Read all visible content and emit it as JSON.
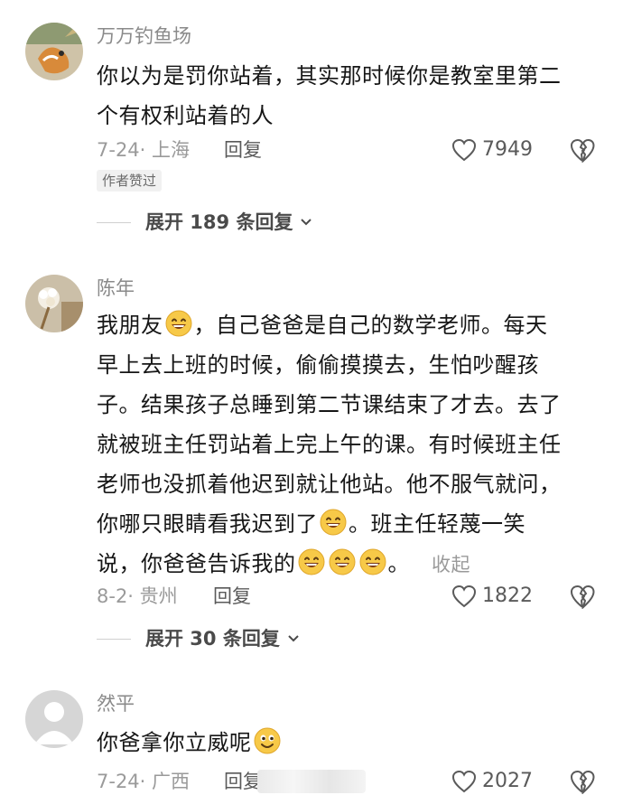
{
  "comments": [
    {
      "user": "万万钓鱼场",
      "text": "你以为是罚你站着，其实那时候你是教室里第二个有权利站着的人",
      "line1": "你以为是罚你站着，其实那时候你是教室里第二",
      "line2": "个有权利站着的人",
      "date_location": "7-24· 上海",
      "reply_label": "回复",
      "likes": "7949",
      "badge": "作者赞过",
      "expand": "展开 189 条回复"
    },
    {
      "user": "陈年",
      "lines": [
        "我朋友",
        "，自己爸爸是自己的数学老师。每天",
        "早上去上班的时候，偷偷摸摸去，生怕吵醒孩",
        "子。结果孩子总睡到第二节课结束了才去。去了",
        "就被班主任罚站着上完上午的课。有时候班主任",
        "老师也没抓着他迟到就让他站。他不服气就问，",
        "你哪只眼睛看我迟到了",
        "。班主任轻蔑一笑",
        "说，你爸爸告诉我的",
        "。"
      ],
      "collapse": "收起",
      "date_location": "8-2· 贵州",
      "reply_label": "回复",
      "likes": "1822",
      "expand": "展开 30 条回复"
    },
    {
      "user": "然平",
      "text": "你爸拿你立威呢",
      "date_location": "7-24· 广西",
      "reply_label": "回复",
      "likes": "2027"
    }
  ],
  "colors": {
    "text": "#161616",
    "meta": "#9a9a9a",
    "emoji": "#f7c948"
  },
  "icons": [
    "heart-outline-icon",
    "broken-heart-icon",
    "chevron-down-icon",
    "grin-emoji-icon",
    "smile-emoji-icon"
  ]
}
